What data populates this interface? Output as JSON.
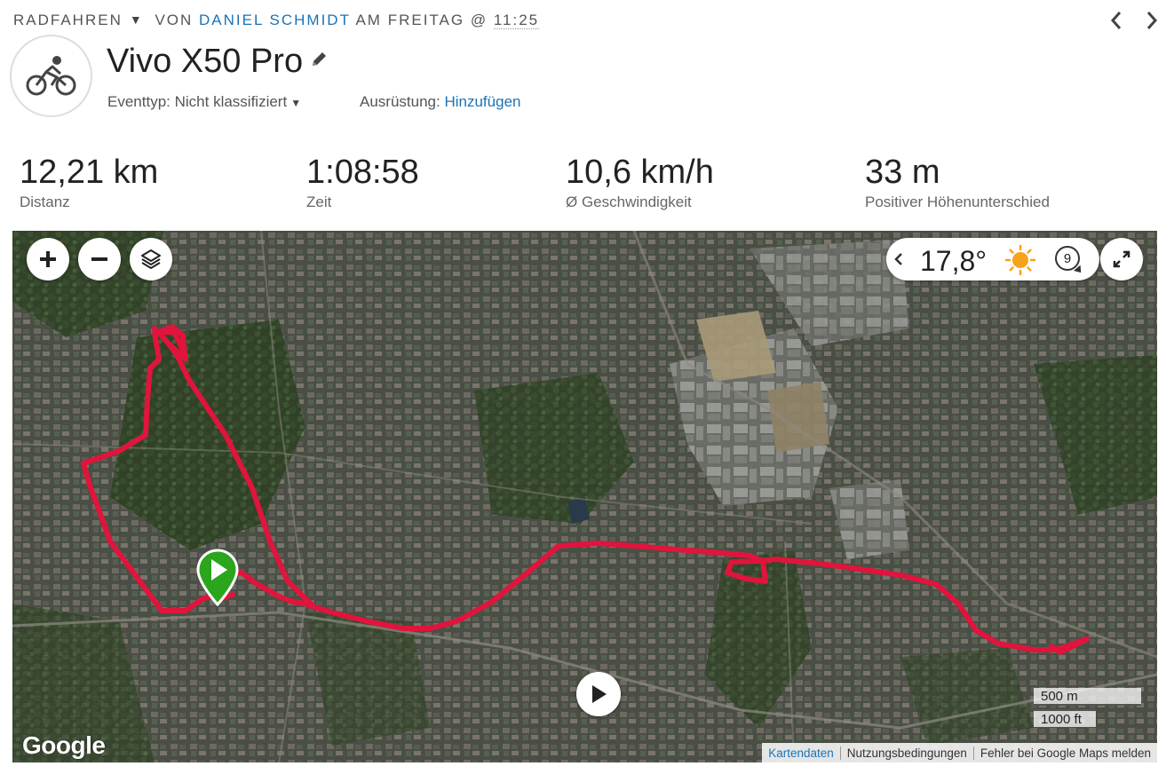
{
  "header": {
    "activity_type": "RADFAHREN",
    "by_prefix": "VON",
    "author": "DANIEL SCHMIDT",
    "when": "AM FREITAG @",
    "time": "11:25",
    "title": "Vivo X50 Pro",
    "event_type_label": "Eventtyp:",
    "event_type_value": "Nicht klassifiziert",
    "gear_label": "Ausrüstung:",
    "gear_link": "Hinzufügen"
  },
  "stats": [
    {
      "value": "12,21 km",
      "label": "Distanz"
    },
    {
      "value": "1:08:58",
      "label": "Zeit"
    },
    {
      "value": "10,6 km/h",
      "label": "Ø Geschwindigkeit"
    },
    {
      "value": "33 m",
      "label": "Positiver Höhenunterschied"
    }
  ],
  "map": {
    "temperature": "17,8°",
    "wind_speed": "9",
    "weather_icon": "sun-icon",
    "scale_metric": "500 m",
    "scale_imperial": "1000 ft",
    "brand": "Google",
    "attribution": [
      "Kartendaten",
      "Nutzungsbedingungen",
      "Fehler bei Google Maps melden"
    ],
    "route_color": "#e0143c",
    "start_marker_color": "#2aa51c"
  },
  "colors": {
    "link": "#1a73b8",
    "text": "#222222",
    "muted": "#666666"
  }
}
